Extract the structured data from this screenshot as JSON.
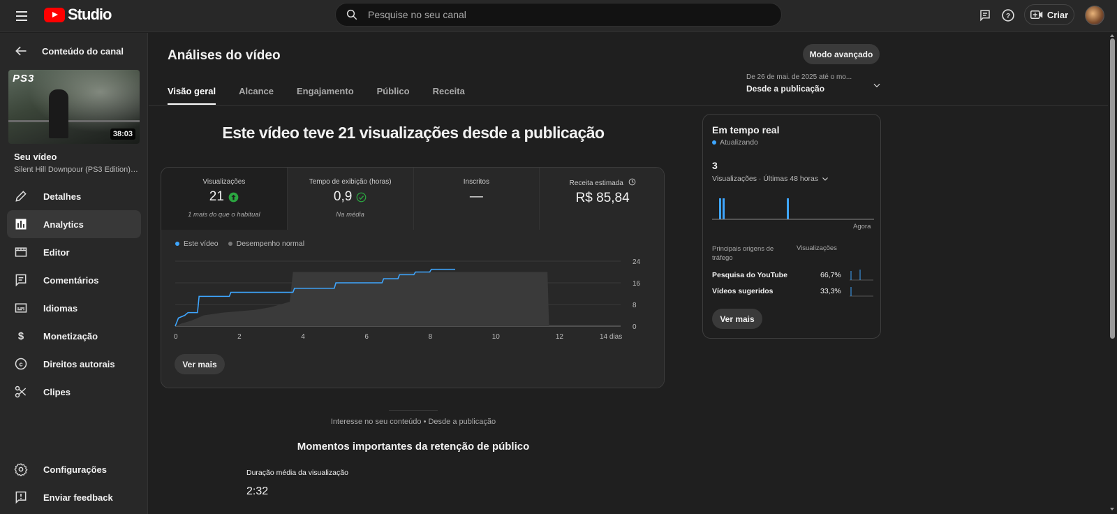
{
  "header": {
    "logo_text": "Studio",
    "search_placeholder": "Pesquise no seu canal",
    "create_label": "Criar",
    "icons": [
      "menu-icon",
      "search-icon",
      "feedback-icon",
      "help-icon",
      "create-video-icon"
    ]
  },
  "sidebar": {
    "back_label": "Conteúdo do canal",
    "thumb_badge": "PS3",
    "duration": "38:03",
    "your_video_label": "Seu vídeo",
    "video_title": "Silent Hill Downpour (PS3 Edition) G...",
    "items": [
      {
        "label": "Detalhes",
        "icon": "pencil-icon"
      },
      {
        "label": "Analytics",
        "icon": "analytics-icon"
      },
      {
        "label": "Editor",
        "icon": "editor-icon"
      },
      {
        "label": "Comentários",
        "icon": "comment-icon"
      },
      {
        "label": "Idiomas",
        "icon": "subtitles-icon"
      },
      {
        "label": "Monetização",
        "icon": "dollar-icon"
      },
      {
        "label": "Direitos autorais",
        "icon": "copyright-icon"
      },
      {
        "label": "Clipes",
        "icon": "scissors-icon"
      }
    ],
    "bottom_items": [
      {
        "label": "Configurações",
        "icon": "gear-icon"
      },
      {
        "label": "Enviar feedback",
        "icon": "feedback-icon"
      }
    ]
  },
  "main": {
    "title": "Análises do vídeo",
    "advanced_mode": "Modo avançado",
    "tabs": [
      {
        "label": "Visão geral"
      },
      {
        "label": "Alcance"
      },
      {
        "label": "Engajamento"
      },
      {
        "label": "Público"
      },
      {
        "label": "Receita"
      }
    ],
    "date_range_small": "De 26 de mai. de 2025 até o mo...",
    "date_range_big": "Desde a publicação",
    "headline": "Este vídeo teve 21 visualizações desde a publicação",
    "metrics": [
      {
        "label": "Visualizações",
        "value": "21",
        "note": "1 mais do que o habitual"
      },
      {
        "label": "Tempo de exibição (horas)",
        "value": "0,9",
        "note": "Na média"
      },
      {
        "label": "Inscritos",
        "value": "—",
        "note": ""
      },
      {
        "label": "Receita estimada",
        "value": "R$ 85,84",
        "note": ""
      }
    ],
    "ver_mais": "Ver mais",
    "interest_text": "Interesse no seu conteúdo • Desde a publicação",
    "retention_title": "Momentos importantes da retenção de público",
    "avg_duration_label": "Duração média da visualização",
    "avg_duration_value": "2:32"
  },
  "chart_data": {
    "type": "line",
    "legend": [
      "Este vídeo",
      "Desempenho normal"
    ],
    "x_ticks": [
      "0",
      "2",
      "4",
      "6",
      "8",
      "10",
      "12",
      "14 dias"
    ],
    "y_ticks": [
      "24",
      "16",
      "8",
      "0"
    ],
    "xlim": [
      0,
      14
    ],
    "ylim": [
      0,
      24
    ],
    "series": [
      {
        "name": "Este vídeo",
        "color": "#3ea6ff",
        "points": [
          [
            0,
            0
          ],
          [
            0.1,
            3
          ],
          [
            0.3,
            4
          ],
          [
            0.4,
            5
          ],
          [
            0.7,
            5
          ],
          [
            0.75,
            11
          ],
          [
            1.7,
            11
          ],
          [
            1.75,
            12.5
          ],
          [
            3.7,
            12.5
          ],
          [
            3.75,
            14
          ],
          [
            5,
            14
          ],
          [
            5.05,
            16
          ],
          [
            6.5,
            16
          ],
          [
            6.55,
            17.5
          ],
          [
            7,
            17.5
          ],
          [
            7.05,
            19
          ],
          [
            7.5,
            19
          ],
          [
            7.55,
            20
          ],
          [
            8,
            20
          ],
          [
            8.05,
            21
          ],
          [
            8.8,
            21
          ]
        ]
      },
      {
        "name": "Desempenho normal",
        "color": "#3a3a3a",
        "points": [
          [
            0,
            0
          ],
          [
            0.2,
            1
          ],
          [
            0.5,
            2
          ],
          [
            0.9,
            4
          ],
          [
            1.5,
            5
          ],
          [
            2.5,
            6
          ],
          [
            3,
            7
          ],
          [
            3.3,
            8
          ],
          [
            3.6,
            9
          ],
          [
            3.7,
            20
          ],
          [
            11.7,
            20
          ],
          [
            11.75,
            0
          ],
          [
            14,
            0
          ]
        ]
      }
    ]
  },
  "realtime": {
    "title": "Em tempo real",
    "status": "Atualizando",
    "count": "3",
    "subtitle": "Visualizações · Últimas 48 horas",
    "now_label": "Agora",
    "sources_header": "Principais origens de tráfego",
    "views_header": "Visualizações",
    "sources": [
      {
        "name": "Pesquisa do YouTube",
        "pct": "66,7%"
      },
      {
        "name": "Vídeos sugeridos",
        "pct": "33,3%"
      }
    ],
    "ver_mais": "Ver mais",
    "accent_color": "#3ea6ff"
  }
}
